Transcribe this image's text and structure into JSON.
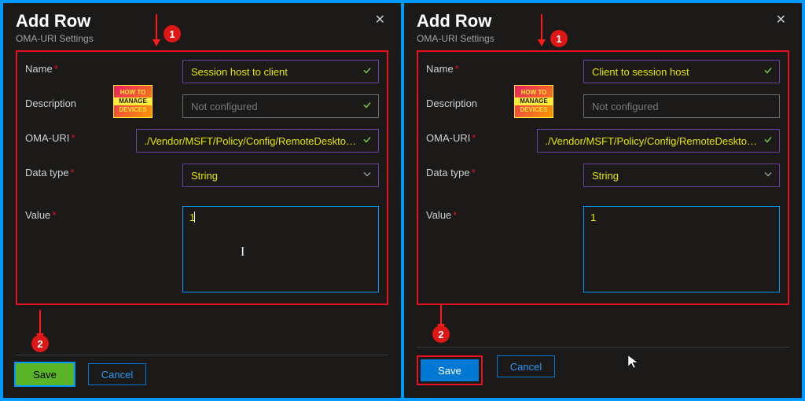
{
  "panels": [
    {
      "title": "Add Row",
      "subtitle": "OMA-URI Settings",
      "labels": {
        "name": "Name",
        "description": "Description",
        "omauri": "OMA-URI",
        "datatype": "Data type",
        "value": "Value"
      },
      "fields": {
        "name": "Session host to client",
        "description_placeholder": "Not configured",
        "omauri": "./Vendor/MSFT/Policy/Config/RemoteDeskto…",
        "datatype": "String",
        "value": "1"
      },
      "buttons": {
        "save": "Save",
        "cancel": "Cancel"
      },
      "save_style": "green",
      "badge1": "1",
      "badge2": "2"
    },
    {
      "title": "Add Row",
      "subtitle": "OMA-URI Settings",
      "labels": {
        "name": "Name",
        "description": "Description",
        "omauri": "OMA-URI",
        "datatype": "Data type",
        "value": "Value"
      },
      "fields": {
        "name": "Client to session host",
        "description_placeholder": "Not configured",
        "omauri": "./Vendor/MSFT/Policy/Config/RemoteDeskto…",
        "datatype": "String",
        "value": "1"
      },
      "buttons": {
        "save": "Save",
        "cancel": "Cancel"
      },
      "save_style": "blue",
      "badge1": "1",
      "badge2": "2"
    }
  ],
  "watermark": {
    "line1": "HOW TO",
    "line2": "MANAGE",
    "line3": "DEVICES"
  }
}
